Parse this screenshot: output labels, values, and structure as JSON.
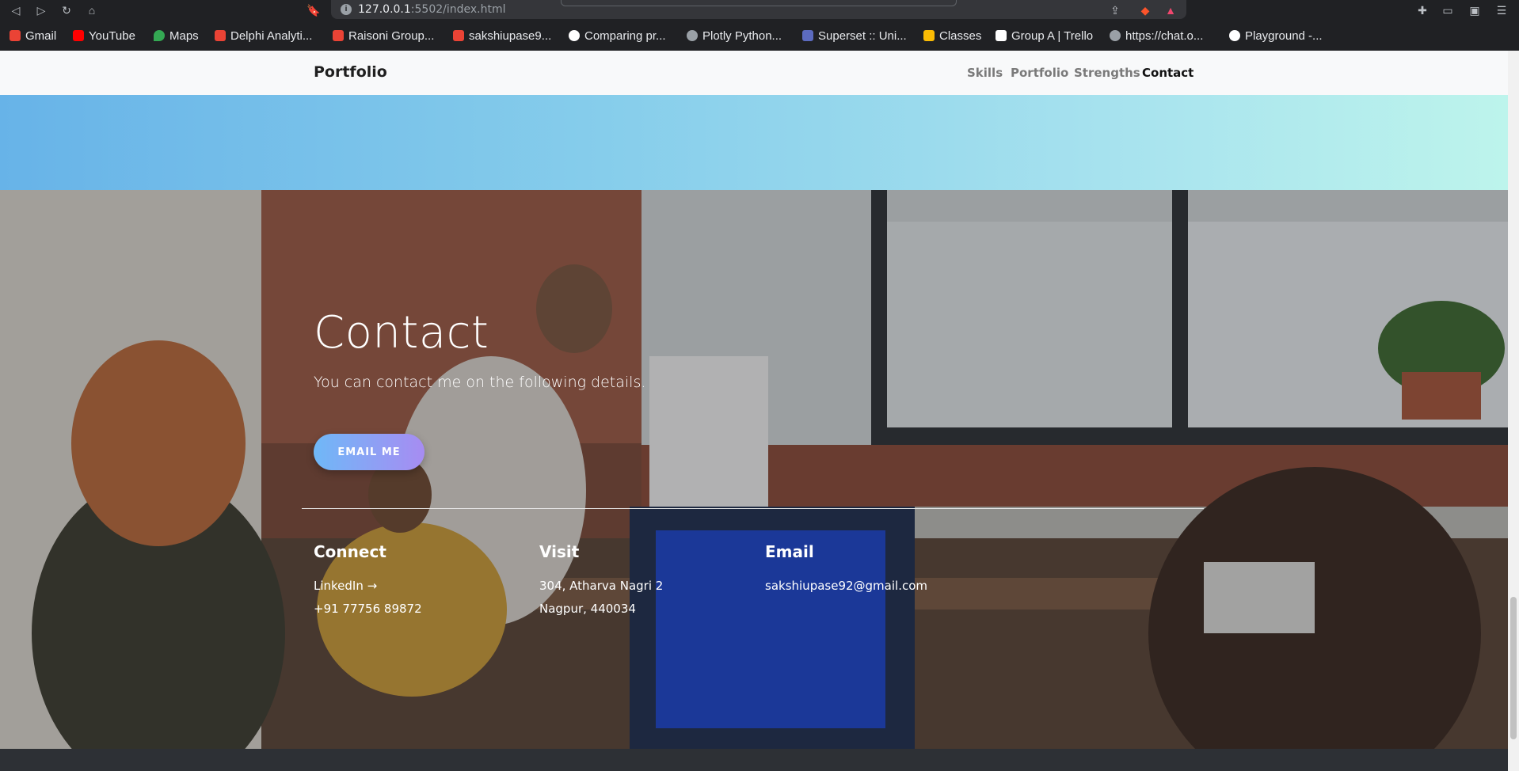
{
  "browser": {
    "url_host": "127.0.0.1",
    "url_path": ":5502/index.html",
    "bookmarks": [
      {
        "label": "Gmail",
        "color": "#ea4335"
      },
      {
        "label": "YouTube",
        "color": "#ff0000"
      },
      {
        "label": "Maps",
        "color": "#34a853"
      },
      {
        "label": "Delphi Analyti...",
        "color": "#ea4335"
      },
      {
        "label": "Raisoni Group...",
        "color": "#ea4335"
      },
      {
        "label": "sakshiupase9...",
        "color": "#ea4335"
      },
      {
        "label": "Comparing pr...",
        "color": "#ffffff"
      },
      {
        "label": "Plotly Python...",
        "color": "#9aa0a6"
      },
      {
        "label": "Superset :: Uni...",
        "color": "#5c6bc0"
      },
      {
        "label": "Classes",
        "color": "#fbbc04"
      },
      {
        "label": "Group A | Trello",
        "color": "#ffffff"
      },
      {
        "label": "https://chat.o...",
        "color": "#9aa0a6"
      },
      {
        "label": "Playground -...",
        "color": "#ffffff"
      }
    ]
  },
  "nav": {
    "brand": "Portfolio",
    "links": [
      "Skills",
      "Portfolio",
      "Strengths",
      "Contact"
    ],
    "active": "Contact"
  },
  "contact": {
    "title": "Contact",
    "subtitle": "You can contact me on the following details.",
    "button": "EMAIL ME",
    "connect": {
      "heading": "Connect",
      "linkedin": "LinkedIn →",
      "phone": "+91 77756 89872"
    },
    "visit": {
      "heading": "Visit",
      "line1": "304, Atharva Nagri 2",
      "line2": "Nagpur, 440034"
    },
    "email": {
      "heading": "Email",
      "address": "sakshiupase92@gmail.com"
    }
  }
}
